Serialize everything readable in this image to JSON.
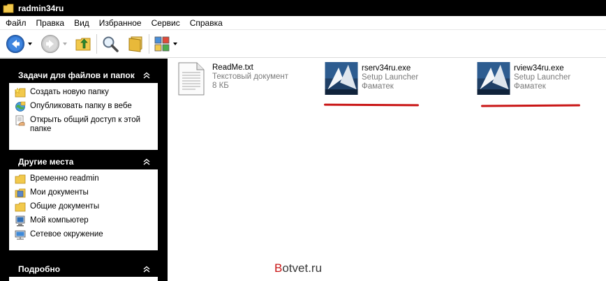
{
  "window": {
    "title": "radmin34ru",
    "folder_icon": "folder-icon"
  },
  "menu": {
    "items": [
      "Файл",
      "Правка",
      "Вид",
      "Избранное",
      "Сервис",
      "Справка"
    ]
  },
  "toolbar": {
    "buttons": [
      "back-icon",
      "forward-icon",
      "up-folder-icon",
      "search-icon",
      "folders-icon",
      "views-icon"
    ]
  },
  "tasks": {
    "title": "Задачи для файлов и папок",
    "items": [
      {
        "label": "Создать новую папку",
        "icon": "new-folder-icon"
      },
      {
        "label": "Опубликовать папку в вебе",
        "icon": "web-publish-icon"
      },
      {
        "label": "Открыть общий доступ к этой папке",
        "icon": "share-icon"
      }
    ]
  },
  "places": {
    "title": "Другие места",
    "items": [
      {
        "label": "Временно readmin",
        "icon": "folder-icon"
      },
      {
        "label": "Мои документы",
        "icon": "my-documents-icon"
      },
      {
        "label": "Общие документы",
        "icon": "folder-icon"
      },
      {
        "label": "Мой компьютер",
        "icon": "my-computer-icon"
      },
      {
        "label": "Сетевое окружение",
        "icon": "network-icon"
      }
    ]
  },
  "details": {
    "title": "Подробно"
  },
  "files": [
    {
      "name": "ReadMe.txt",
      "line2": "Текстовый документ",
      "line3": "8 КБ",
      "icon": "text-document-icon"
    },
    {
      "name": "rserv34ru.exe",
      "line2": "Setup Launcher",
      "line3": "Фаматек",
      "icon": "installer-icon"
    },
    {
      "name": "rview34ru.exe",
      "line2": "Setup Launcher",
      "line3": "Фаматек",
      "icon": "installer-icon"
    }
  ],
  "watermark": {
    "first": "B",
    "rest": "otvet.ru"
  },
  "colors": {
    "underline": "#c91515",
    "panel_header": "#000000"
  }
}
